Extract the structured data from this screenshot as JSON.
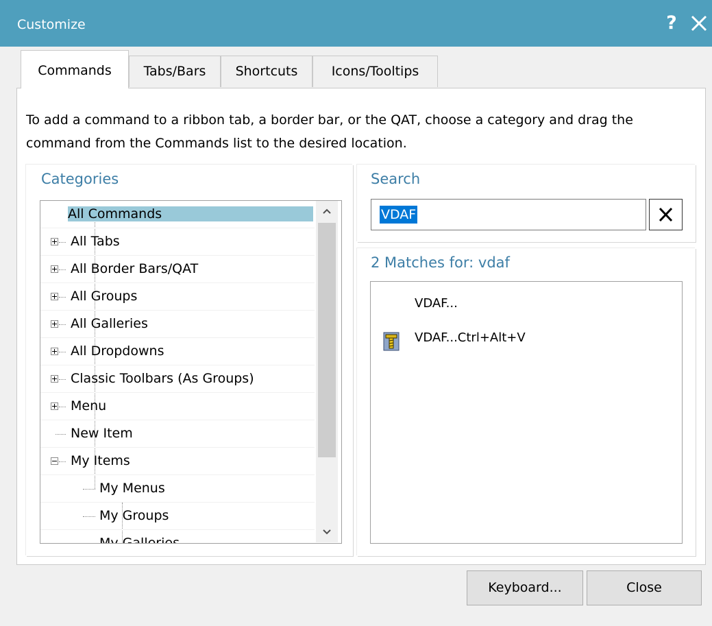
{
  "window": {
    "title": "Customize",
    "help_label": "?"
  },
  "tabs": [
    {
      "label": "Commands",
      "active": true
    },
    {
      "label": "Tabs/Bars",
      "active": false
    },
    {
      "label": "Shortcuts",
      "active": false
    },
    {
      "label": "Icons/Tooltips",
      "active": false
    }
  ],
  "instructions": "To add a command to a ribbon tab, a border bar, or the QAT, choose a category and drag the command from the Commands list to the desired location.",
  "categories": {
    "heading": "Categories",
    "items": [
      {
        "label": "All Commands",
        "selected": true
      },
      {
        "label": "All Tabs"
      },
      {
        "label": "All Border Bars/QAT"
      },
      {
        "label": "All Groups"
      },
      {
        "label": "All Galleries"
      },
      {
        "label": "All Dropdowns"
      },
      {
        "label": "Classic Toolbars (As Groups)"
      },
      {
        "label": "Menu"
      },
      {
        "label": "New Item"
      },
      {
        "label": "My Items",
        "expanded": true
      },
      {
        "label": "My Menus"
      },
      {
        "label": "My Groups"
      },
      {
        "label": "My Galleries"
      }
    ]
  },
  "search": {
    "heading": "Search",
    "value": "VDAF",
    "clear_label": "X"
  },
  "results": {
    "heading": "2 Matches for: vdaf",
    "items": [
      {
        "label": "VDAF...",
        "icon": ""
      },
      {
        "label": "VDAF...Ctrl+Alt+V",
        "icon": "screw-icon"
      }
    ]
  },
  "buttons": {
    "keyboard_label": "Keyboard...",
    "close_label": "Close"
  }
}
